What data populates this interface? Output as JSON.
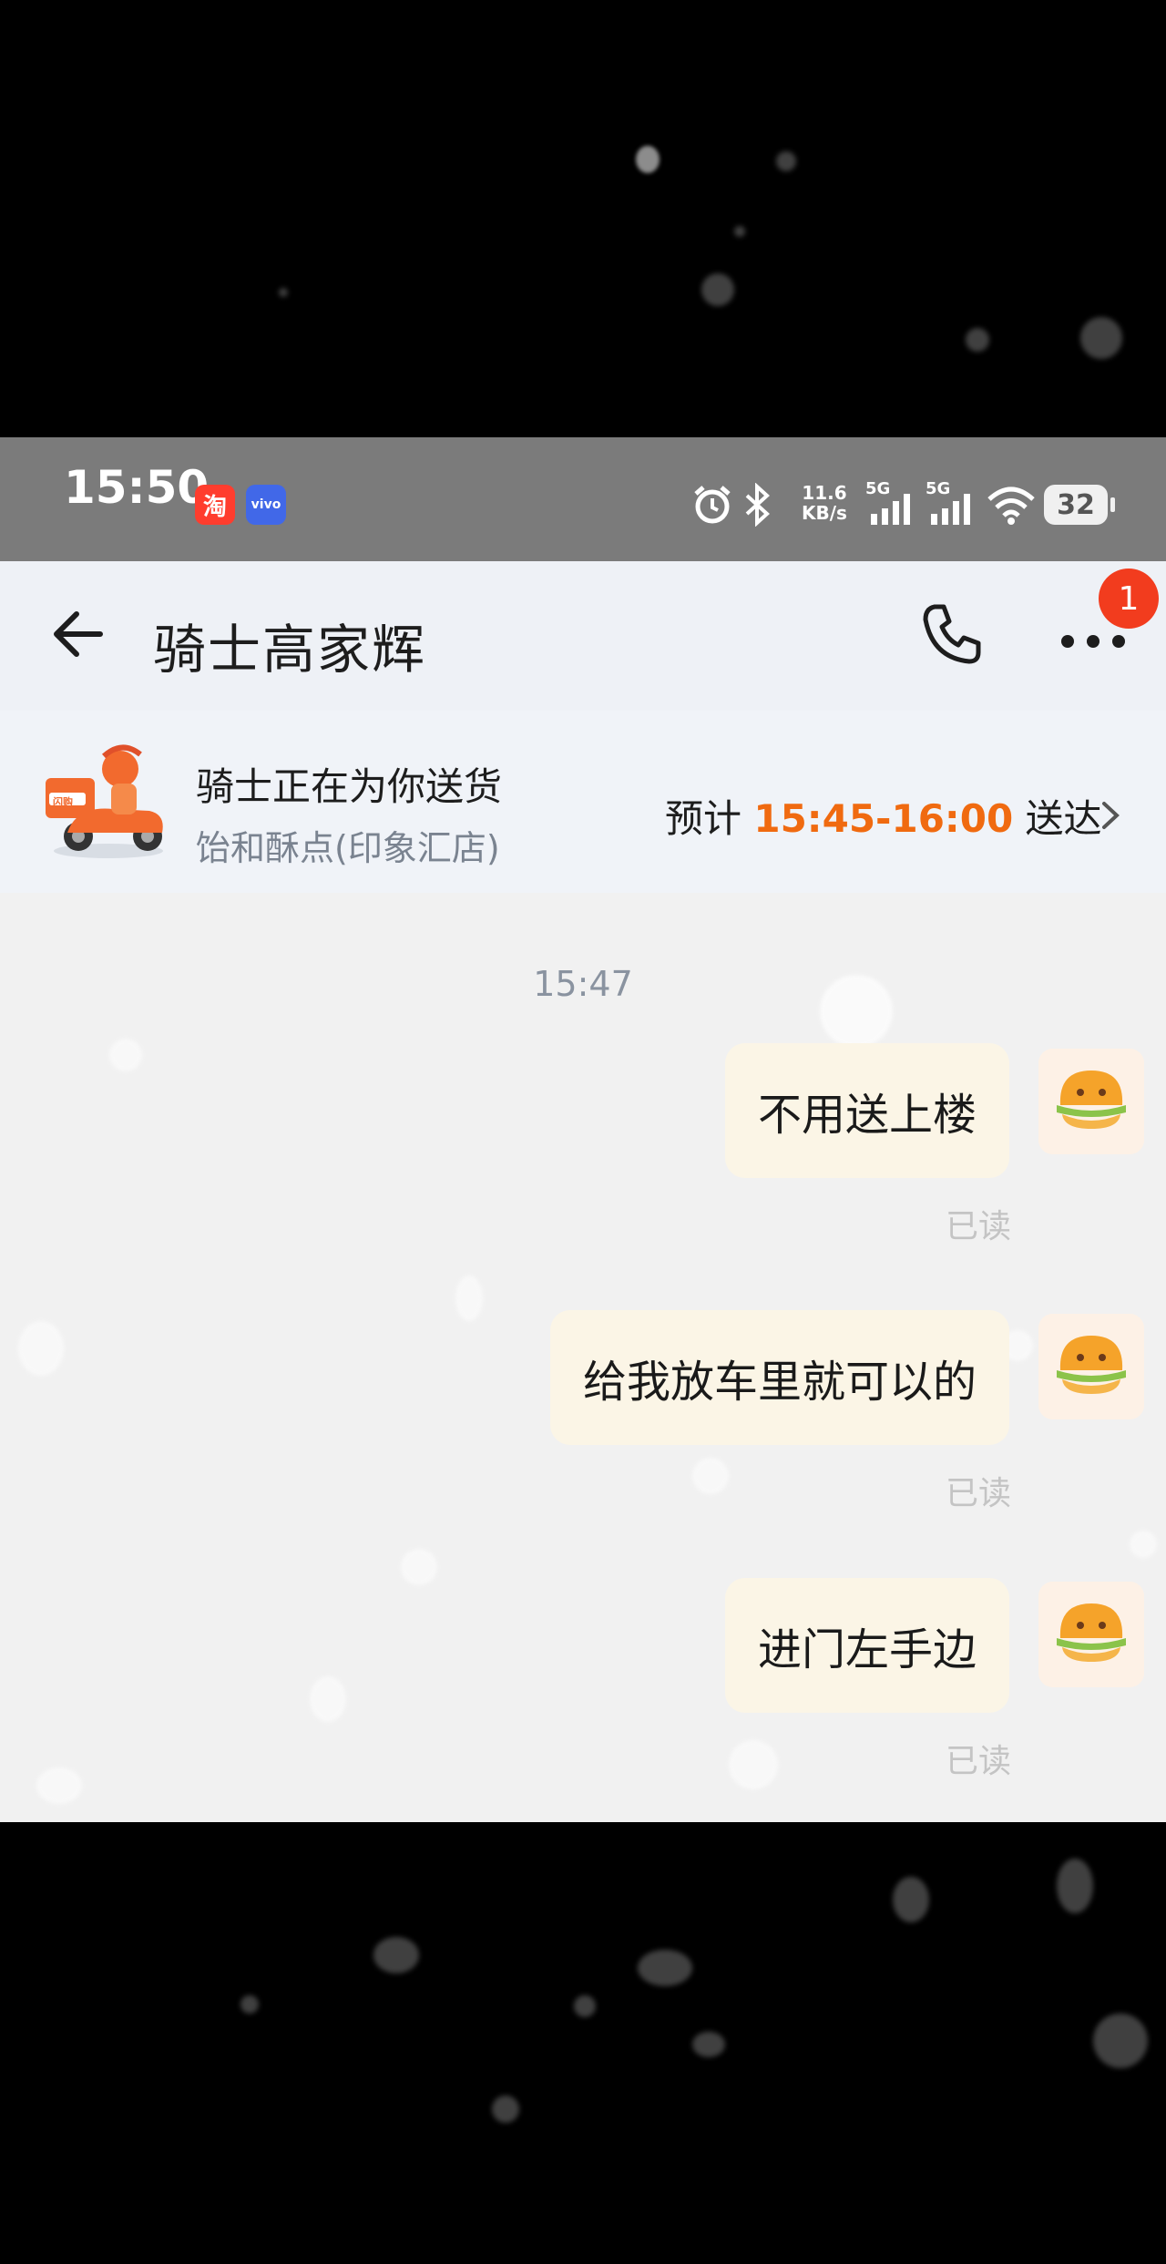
{
  "status_bar": {
    "time": "15:50",
    "taobao_badge": "淘",
    "vivo_badge": "vivo",
    "net_speed_value": "11.6",
    "net_speed_unit": "KB/s",
    "sim1": "5G",
    "sim2": "5G",
    "battery": "32"
  },
  "header": {
    "title": "骑士高家辉",
    "notification_count": "1"
  },
  "delivery": {
    "status": "骑士正在为你送货",
    "shop": "饴和酥点(印象汇店)",
    "eta_prefix": "预计 ",
    "eta_time": "15:45-16:00",
    "eta_suffix": " 送达",
    "avatar_label": "闪购"
  },
  "chat": {
    "timestamp": "15:47",
    "messages": [
      {
        "text": "不用送上楼",
        "status": "已读"
      },
      {
        "text": "给我放车里就可以的",
        "status": "已读"
      },
      {
        "text": "进门左手边",
        "status": "已读"
      }
    ]
  },
  "colors": {
    "accent_orange": "#f06a10",
    "badge_red": "#f23c1e",
    "bubble": "#fbf5e6"
  }
}
